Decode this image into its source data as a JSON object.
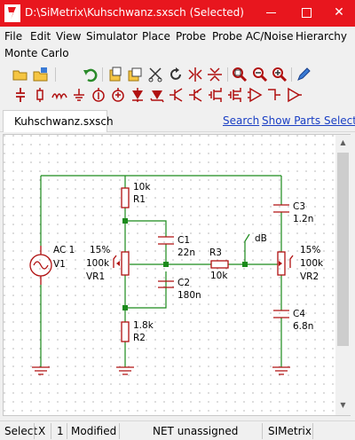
{
  "window": {
    "title": "D:\\SiMetrix\\Kuhschwanz.sxsch (Selected)",
    "title_color": "#e8161e"
  },
  "menu": {
    "items": [
      "File",
      "Edit",
      "View",
      "Simulator",
      "Place",
      "Probe",
      "Probe AC/Noise",
      "Hierarchy",
      "Monte Carlo"
    ]
  },
  "toolbar1": {
    "icons": [
      "open-folder-icon",
      "save-icon",
      "undo-icon",
      "new-schematic-icon",
      "duplicate-icon",
      "cut-icon",
      "rotate-icon",
      "mirror-lr-icon",
      "mirror-ud-icon",
      "zoom-full-icon",
      "zoom-out-icon",
      "zoom-in-icon",
      "pen-icon"
    ]
  },
  "toolbar2": {
    "icons": [
      "capacitor-icon",
      "resistor-icon",
      "inductor-icon",
      "ground-icon",
      "current-source-icon",
      "voltage-source-icon",
      "diode-icon",
      "zener-icon",
      "npn-icon",
      "pnp-icon",
      "nmos-icon",
      "pmos-icon",
      "opamp-icon",
      "terminal-icon",
      "buffer-icon"
    ]
  },
  "tabs": {
    "active": "Kuhschwanz.sxsch",
    "search_link": "Search",
    "parts_link": "Show Parts Selector"
  },
  "schematic": {
    "wire_color": "#1a8a1a",
    "component_color": "#b01010",
    "labels": {
      "r1_value": "10k",
      "r1_ref": "R1",
      "c1_ref": "C1",
      "c1_value": "22n",
      "c2_ref": "C2",
      "c2_value": "180n",
      "r2_value": "1.8k",
      "r2_ref": "R2",
      "r3_ref": "R3",
      "r3_value": "10k",
      "probe_label": "dB",
      "c3_ref": "C3",
      "c3_value": "1.2n",
      "c4_ref": "C4",
      "c4_value": "6.8n",
      "v1_line1": "AC 1",
      "v1_ref": "V1",
      "vr1_pct": "15%",
      "vr1_value": "100k",
      "vr1_ref": "VR1",
      "vr2_pct": "15%",
      "vr2_value": "100k",
      "vr2_ref": "VR2"
    }
  },
  "status": {
    "mode": "Select",
    "x_label": "X",
    "count": "1",
    "modified": "Modified",
    "net": "NET unassigned",
    "app": "SIMetrix"
  }
}
